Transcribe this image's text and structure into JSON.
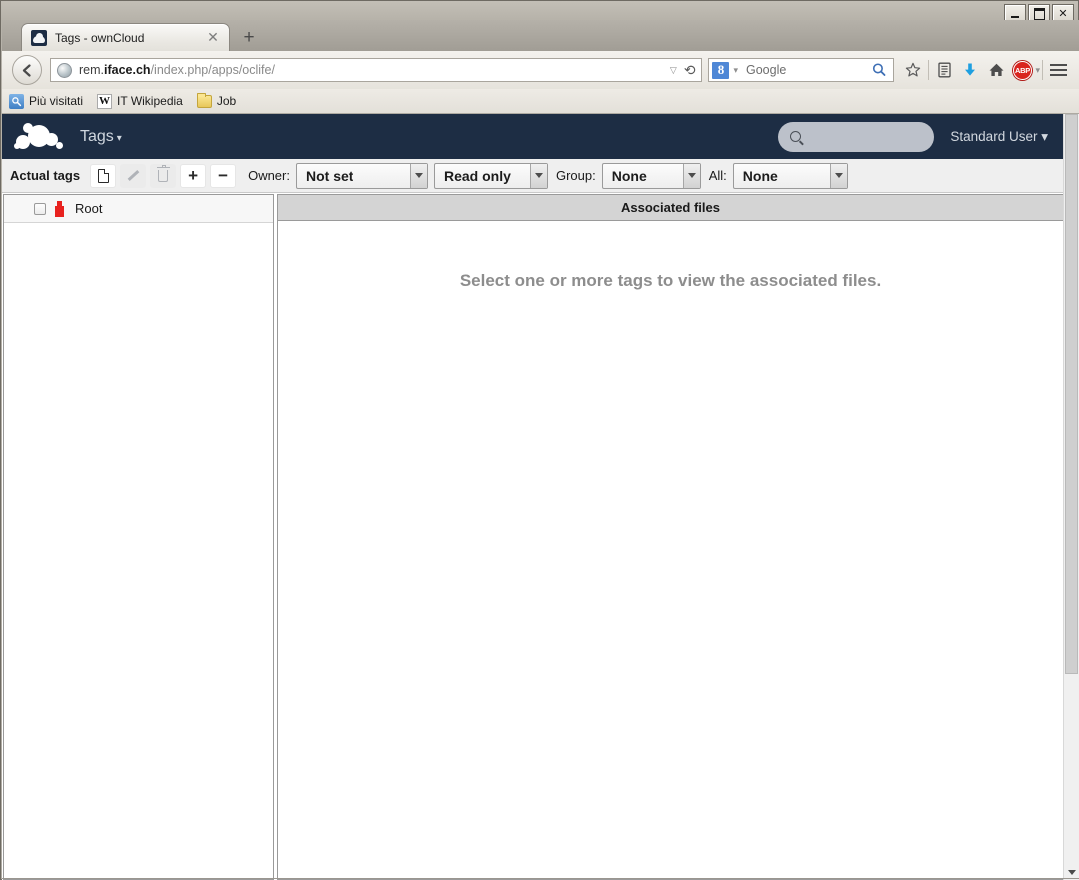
{
  "window": {
    "controls": {
      "minimize": "_",
      "maximize": "□",
      "close": "✕"
    }
  },
  "browser": {
    "tab": {
      "title": "Tags - ownCloud",
      "favicon": "owncloud-favicon",
      "close_label": "✕"
    },
    "new_tab_label": "+",
    "back_label": "◀",
    "url": {
      "prefix": "rem.",
      "host": "iface.ch",
      "path": "/index.php/apps/oclife/"
    },
    "urlbar": {
      "dropdown_caret": "▽",
      "reload_label": "⟳"
    },
    "search": {
      "engine_badge": "8",
      "engine_caret": "▾",
      "placeholder": "Google",
      "submit_icon": "magnifier-icon"
    },
    "toolbar_icons": [
      {
        "name": "bookmark-star-icon",
        "glyph": "☆"
      },
      {
        "name": "reading-list-icon",
        "glyph": "▤"
      },
      {
        "name": "downloads-icon",
        "glyph": "⬇"
      },
      {
        "name": "home-icon",
        "glyph": "⌂"
      },
      {
        "name": "adblock-plus-icon",
        "glyph": "ABP"
      },
      {
        "name": "adblock-caret",
        "glyph": "▾"
      },
      {
        "name": "menu-hamburger-icon",
        "glyph": "≡"
      }
    ],
    "bookmarks": [
      {
        "label": "Più visitati",
        "icon": "most-visited-icon"
      },
      {
        "label": "IT Wikipedia",
        "icon": "wikipedia-icon"
      },
      {
        "label": "Job",
        "icon": "folder-icon"
      }
    ]
  },
  "owncloud": {
    "header": {
      "logo": "owncloud-logo",
      "app_title": "Tags",
      "app_caret": "▾",
      "search_placeholder": "",
      "search_icon": "search-icon",
      "user_name": "Standard User",
      "user_caret": "▾",
      "background_color": "#1d2d44"
    },
    "toolbar": {
      "section_label": "Actual tags",
      "buttons": [
        {
          "name": "new-tag-button",
          "icon": "document-icon",
          "enabled": true
        },
        {
          "name": "edit-tag-button",
          "icon": "pencil-icon",
          "enabled": false
        },
        {
          "name": "delete-tag-button",
          "icon": "trash-icon",
          "enabled": false
        },
        {
          "name": "add-button",
          "icon": "plus-icon",
          "label": "+",
          "enabled": true
        },
        {
          "name": "remove-button",
          "icon": "minus-icon",
          "label": "−",
          "enabled": true
        }
      ],
      "owner_label": "Owner:",
      "owner_value": "Not set",
      "permission_value": "Read only",
      "group_label": "Group:",
      "group_value": "None",
      "all_label": "All:",
      "all_value": "None"
    },
    "tree": {
      "items": [
        {
          "label": "Root",
          "checked": false,
          "icon": "tag-icon",
          "icon_color": "#e8221f"
        }
      ]
    },
    "files_pane": {
      "header": "Associated files",
      "empty_message": "Select one or more tags to view the associated files."
    }
  }
}
